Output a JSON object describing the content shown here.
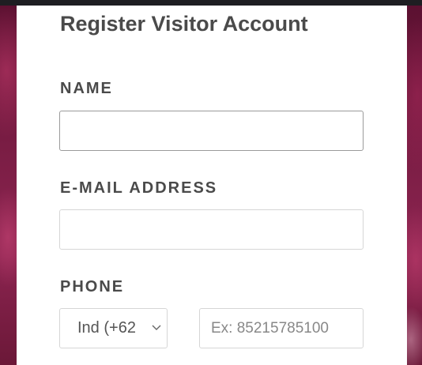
{
  "form": {
    "title": "Register Visitor Account",
    "name_label": "NAME",
    "name_value": "",
    "email_label": "E-MAIL ADDRESS",
    "email_value": "",
    "phone_label": "PHONE",
    "country_selected": "Ind (+62",
    "country_icon": "chevron-down-icon",
    "phone_placeholder": "Ex: 85215785100",
    "phone_value": ""
  },
  "colors": {
    "text": "#4a4a4a",
    "background": "#7a1d44",
    "card": "#ffffff",
    "border": "#d6d6d6"
  }
}
